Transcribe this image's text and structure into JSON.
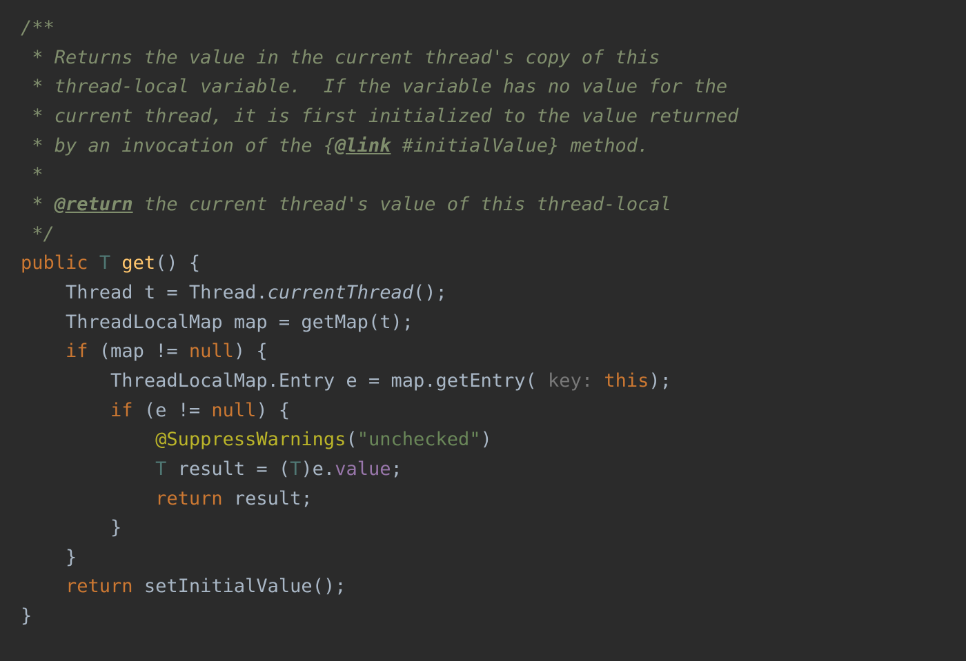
{
  "doc": {
    "l1": "/**",
    "l2": " * Returns the value in the current thread's copy of this",
    "l3": " * thread-local variable.  If the variable has no value for the",
    "l4": " * current thread, it is first initialized to the value returned",
    "l5_a": " * by an invocation of the {",
    "l5_link": "@link",
    "l5_b": " #initialValue} method.",
    "l6": " *",
    "l7_a": " * ",
    "l7_tag": "@return",
    "l7_b": " the current thread's value of this thread-local",
    "l8": " */"
  },
  "code": {
    "kw_public": "public",
    "generic_T": "T",
    "method_get": "get",
    "parens_empty": "()",
    "brace_open": " {",
    "brace_close": "}",
    "indent1": "    ",
    "indent2": "        ",
    "indent3": "            ",
    "type_Thread": "Thread",
    "var_t": " t ",
    "eq": "= ",
    "Thread_dot": "Thread.",
    "call_currentThread": "currentThread",
    "empty_call_semi": "();",
    "type_ThreadLocalMap": "ThreadLocalMap",
    "var_map": " map ",
    "call_getMap": "getMap",
    "args_t": "(t);",
    "kw_if": "if",
    "cond_map": " (map != ",
    "kw_null": "null",
    "close_cond_brace": ") {",
    "type_TLM_Entry": "ThreadLocalMap.Entry",
    "var_e": " e ",
    "map_dot": "map.",
    "call_getEntry": "getEntry",
    "open_paren": "(",
    "hint_key": " key: ",
    "kw_this": "this",
    "close_call_semi": ");",
    "cond_e": " (e != ",
    "annotation": "@SuppressWarnings",
    "anno_open": "(",
    "anno_str": "\"unchecked\"",
    "anno_close": ")",
    "result_decl_a": " result = (",
    "result_cast_close": ")e.",
    "field_value": "value",
    "semi": ";",
    "kw_return": "return",
    "ret_result": " result;",
    "call_setInitialValue": "setInitialValue",
    "ret_space": " "
  }
}
